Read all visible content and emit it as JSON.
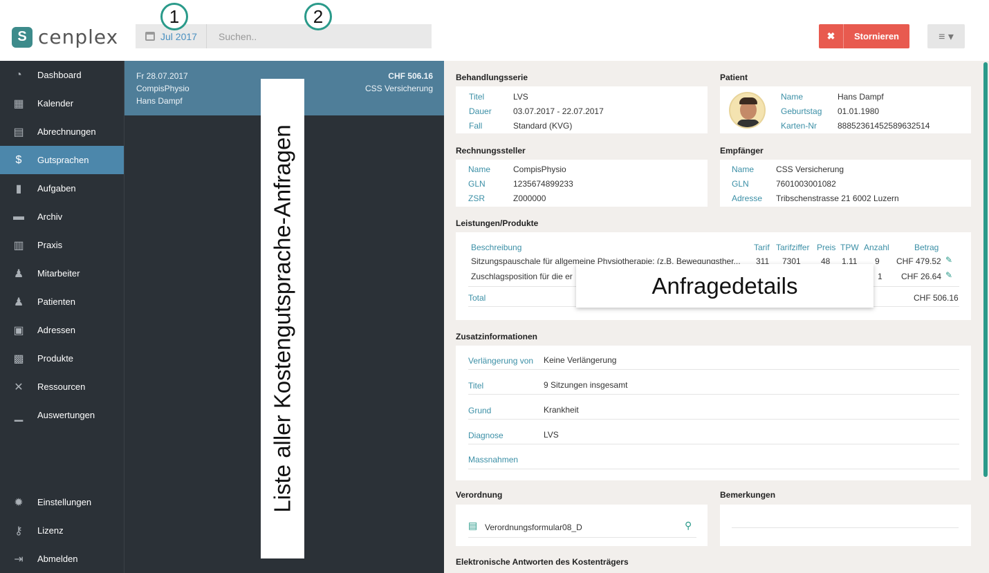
{
  "app": {
    "logo_text": "cenplex",
    "logo_mark": "S"
  },
  "header": {
    "date_label": "Jul 2017",
    "search_placeholder": "Suchen..",
    "badge1": "1",
    "badge2": "2",
    "cancel_label": "Stornieren",
    "cancel_icon": "close-icon",
    "menu_icon": "hamburger-icon"
  },
  "sidebar": {
    "items": [
      {
        "label": "Dashboard",
        "icon": "dashboard-icon",
        "glyph": "◔"
      },
      {
        "label": "Kalender",
        "icon": "calendar-icon",
        "glyph": "▦"
      },
      {
        "label": "Abrechnungen",
        "icon": "calculator-icon",
        "glyph": "▤"
      },
      {
        "label": "Gutsprachen",
        "icon": "dollar-icon",
        "glyph": "$"
      },
      {
        "label": "Aufgaben",
        "icon": "clipboard-icon",
        "glyph": "▮"
      },
      {
        "label": "Archiv",
        "icon": "archive-icon",
        "glyph": "▬"
      },
      {
        "label": "Praxis",
        "icon": "building-icon",
        "glyph": "▥"
      },
      {
        "label": "Mitarbeiter",
        "icon": "staff-icon",
        "glyph": "♟"
      },
      {
        "label": "Patienten",
        "icon": "patients-icon",
        "glyph": "♟"
      },
      {
        "label": "Adressen",
        "icon": "addressbook-icon",
        "glyph": "▣"
      },
      {
        "label": "Produkte",
        "icon": "shop-icon",
        "glyph": "▩"
      },
      {
        "label": "Ressourcen",
        "icon": "tools-icon",
        "glyph": "✕"
      },
      {
        "label": "Auswertungen",
        "icon": "chart-icon",
        "glyph": "▁"
      }
    ],
    "bottom": [
      {
        "label": "Einstellungen",
        "icon": "gear-icon",
        "glyph": "✹"
      },
      {
        "label": "Lizenz",
        "icon": "key-icon",
        "glyph": "⚷"
      },
      {
        "label": "Abmelden",
        "icon": "logout-icon",
        "glyph": "⇥"
      }
    ],
    "active": "Gutsprachen"
  },
  "list": {
    "rows": [
      {
        "date": "Fr 28.07.2017",
        "provider": "CompisPhysio",
        "patient": "Hans Dampf",
        "amount": "CHF 506.16",
        "insurer": "CSS Versicherung"
      }
    ],
    "annotation": "Liste aller Kostengutsprache-Anfragen"
  },
  "detail": {
    "annotation": "Anfragedetails",
    "behandlungsserie": {
      "title": "Behandlungsserie",
      "rows": [
        {
          "k": "Titel",
          "v": "LVS"
        },
        {
          "k": "Dauer",
          "v": "03.07.2017 - 22.07.2017"
        },
        {
          "k": "Fall",
          "v": "Standard (KVG)"
        }
      ]
    },
    "patient": {
      "title": "Patient",
      "rows": [
        {
          "k": "Name",
          "v": "Hans Dampf"
        },
        {
          "k": "Geburtstag",
          "v": "01.01.1980"
        },
        {
          "k": "Karten-Nr",
          "v": "88852361452589632514"
        }
      ]
    },
    "rechnungssteller": {
      "title": "Rechnungssteller",
      "rows": [
        {
          "k": "Name",
          "v": "CompisPhysio"
        },
        {
          "k": "GLN",
          "v": "1235674899233"
        },
        {
          "k": "ZSR",
          "v": "Z000000"
        }
      ]
    },
    "empfaenger": {
      "title": "Empfänger",
      "rows": [
        {
          "k": "Name",
          "v": "CSS Versicherung"
        },
        {
          "k": "GLN",
          "v": "7601003001082"
        },
        {
          "k": "Adresse",
          "v": "Tribschenstrasse 21 6002 Luzern"
        }
      ]
    },
    "leistungen": {
      "title": "Leistungen/Produkte",
      "headers": [
        "Beschreibung",
        "Tarif",
        "Tarifziffer",
        "Preis",
        "TPW",
        "Anzahl",
        "Betrag"
      ],
      "rows": [
        {
          "desc": "Sitzungspauschale für allgemeine Physiotherapie; (z.B. Bewegungsther...",
          "tarif": "311",
          "ziffer": "7301",
          "preis": "48",
          "tpw": "1.11",
          "anzahl": "9",
          "betrag": "CHF 479.52"
        },
        {
          "desc": "Zuschlagsposition für die er",
          "tarif": "",
          "ziffer": "",
          "preis": "",
          "tpw": "",
          "anzahl": "1",
          "betrag": "CHF 26.64"
        }
      ],
      "total_label": "Total",
      "total_value": "CHF 506.16"
    },
    "zusatz": {
      "title": "Zusatzinformationen",
      "rows": [
        {
          "k": "Verlängerung von",
          "v": "Keine Verlängerung"
        },
        {
          "k": "Titel",
          "v": "9 Sitzungen insgesamt"
        },
        {
          "k": "Grund",
          "v": "Krankheit"
        },
        {
          "k": "Diagnose",
          "v": "LVS"
        },
        {
          "k": "Massnahmen",
          "v": ""
        }
      ]
    },
    "verordnung": {
      "title": "Verordnung",
      "file": "Verordnungsformular08_D"
    },
    "bemerkungen": {
      "title": "Bemerkungen"
    },
    "elektronisch": {
      "title": "Elektronische Antworten des Kostenträgers"
    }
  }
}
